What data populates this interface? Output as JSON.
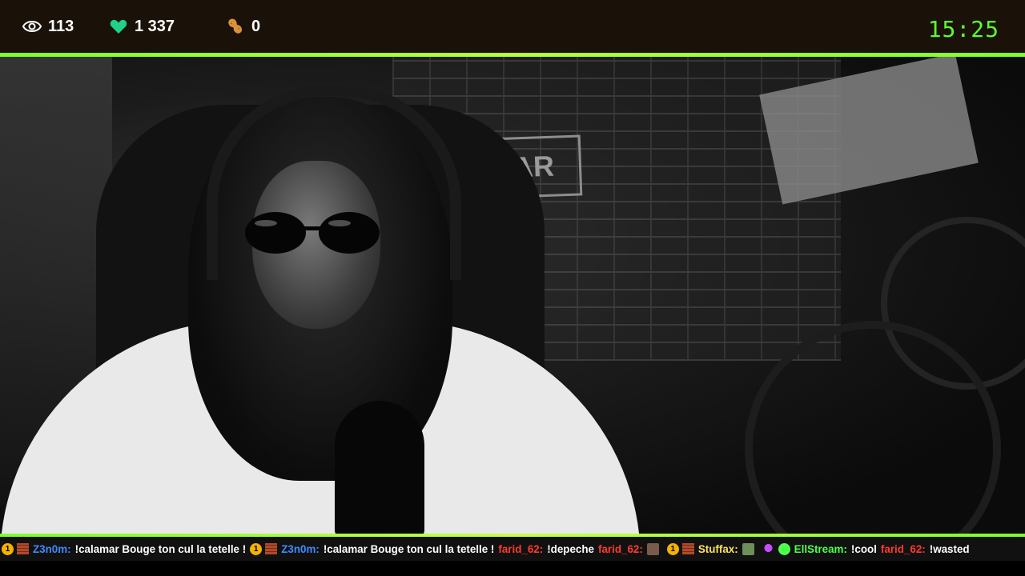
{
  "stats": {
    "viewers": "113",
    "likes": "1 337",
    "peanuts": "0",
    "viewers_icon": "eye-icon",
    "likes_icon": "heart-icon",
    "peanuts_icon": "peanut-icon"
  },
  "clock": "15:25",
  "colors": {
    "accent": "#7dff2a",
    "clock": "#5bff2e",
    "heart": "#1fd18a",
    "name_blue": "#3d8bff",
    "name_red": "#ff3b2e",
    "name_yellow": "#ffe15a",
    "name_green": "#4dff4d"
  },
  "video": {
    "sign_text": "BAR"
  },
  "ticker": {
    "messages": [
      {
        "user": "Z3n0m:",
        "text": "!calamar Bouge ton cul la tetelle !",
        "user_color": "#3d8bff",
        "badges": [
          "sub-badge",
          "brick-badge"
        ],
        "sub": "1"
      },
      {
        "user": "Z3n0m:",
        "text": "!calamar Bouge ton cul la tetelle !",
        "user_color": "#3d8bff",
        "badges": [
          "sub-badge",
          "brick-badge"
        ],
        "sub": "1"
      },
      {
        "user": "farid_62:",
        "text": "!depeche",
        "user_color": "#ff3b2e",
        "badges": []
      },
      {
        "user": "farid_62:",
        "text": "",
        "user_color": "#ff3b2e",
        "badges": [],
        "emote": "face-emote-icon"
      },
      {
        "user": "Stuffax:",
        "text": "",
        "user_color": "#ffe15a",
        "badges": [
          "sub-badge",
          "brick-badge"
        ],
        "sub": "1",
        "emote": "cat-emote-icon"
      },
      {
        "user": "EllStream:",
        "text": "!cool",
        "user_color": "#4dff4d",
        "badges": [
          "mic-badge",
          "verified-badge"
        ]
      },
      {
        "user": "farid_62:",
        "text": "!wasted",
        "user_color": "#ff3b2e",
        "badges": []
      }
    ]
  }
}
